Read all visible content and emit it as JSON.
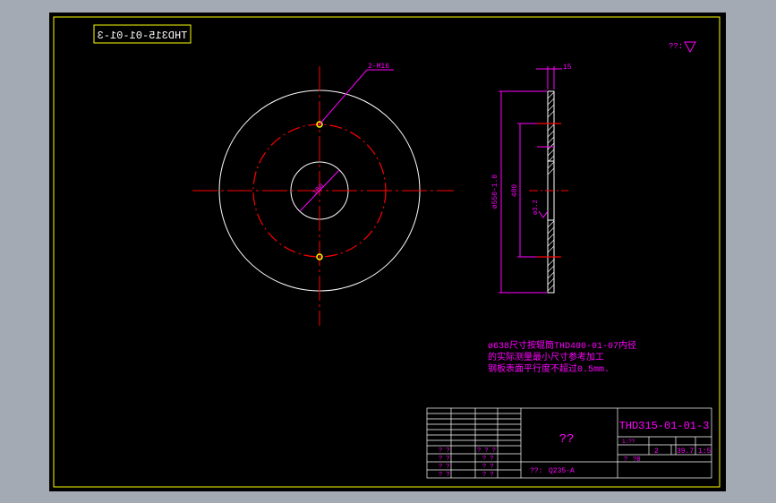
{
  "drawing": {
    "number_mirrored": "THD315-01-01-3",
    "roughness_top": "??:",
    "dim_holes": "2-M16",
    "dim_center": "180",
    "dim_thickness": "15",
    "dim_outer": "ø550-1.0",
    "dim_pitch": "480",
    "dim_chamfer": "ø3.2",
    "notes": [
      "ø638尺寸按辊筒THD400-01-07内径",
      "的实际测量最小尺寸参考加工",
      "钢板表面平行度不超过0.5mm."
    ]
  },
  "title_block": {
    "part_name": "??",
    "drawing_number": "THD315-01-01-3",
    "material_label": "??:",
    "material": "Q235-A",
    "scale_header": "1:??",
    "sheet_count": "2",
    "weight": "39.7",
    "scale": "1:5",
    "sheet_label": "?",
    "sheet_of": "?8",
    "left_marks": [
      "? ?",
      "? ?",
      "? ?",
      "? ?"
    ],
    "mid_marks": [
      "? ? ?",
      "? ?",
      "? ?",
      "? ?"
    ]
  },
  "colors": {
    "background": "#000000",
    "frame": "#ffff00",
    "geometry": "#ffffff",
    "centerline": "#ff0000",
    "dimension": "#ff00ff",
    "hole": "#ffff00"
  }
}
